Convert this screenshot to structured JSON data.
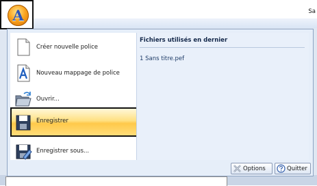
{
  "window": {
    "title": "Sa"
  },
  "app_button": {
    "glyph": "A",
    "icon": "app-orb-logo"
  },
  "menu": {
    "items": [
      {
        "label": "Créer nouvelle police",
        "icon": "new-document-icon"
      },
      {
        "label": "Nouveau mappage de police",
        "icon": "font-mapping-icon"
      },
      {
        "label": "Ouvrir...",
        "icon": "open-folder-icon"
      },
      {
        "label": "Enregistrer",
        "icon": "save-disk-icon",
        "highlighted": true
      },
      {
        "label": "Enregistrer sous...",
        "icon": "save-as-icon"
      }
    ],
    "recent": {
      "header": "Fichiers utilisés en dernier",
      "files": [
        {
          "label": "1 Sans titre.pef"
        }
      ]
    },
    "footer": {
      "options_label": "Options",
      "quit_label": "Quitter"
    }
  },
  "colors": {
    "highlight_top": "#fff8da",
    "highlight_bottom": "#ffc94a",
    "menu_background": "#e6eef9",
    "app_orb": "#f9a420"
  }
}
